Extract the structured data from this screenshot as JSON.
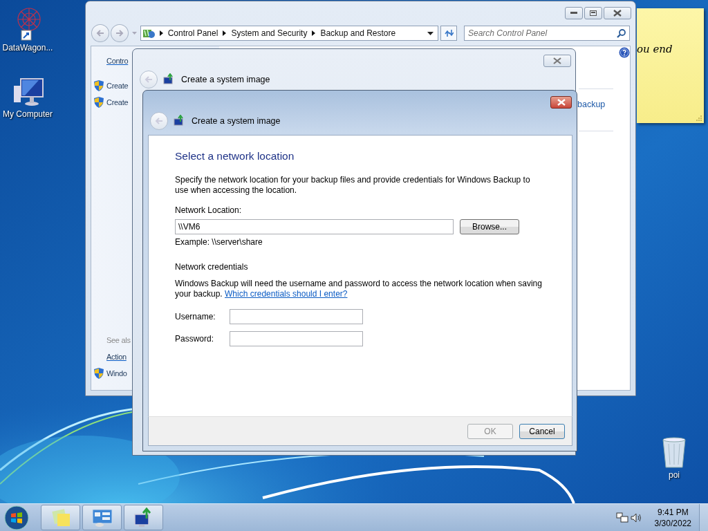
{
  "desktop_icons": [
    {
      "label": "DataWagon...",
      "kind": "app"
    },
    {
      "label": "My Computer",
      "kind": "computer"
    },
    {
      "label": "poi",
      "kind": "bin"
    }
  ],
  "sticky_note": {
    "text": "ou end"
  },
  "control_panel": {
    "breadcrumb": [
      "Control Panel",
      "System and Security",
      "Backup and Restore"
    ],
    "search": {
      "placeholder": "Search Control Panel"
    },
    "sidebar": [
      {
        "label": "Contro",
        "kind": "link"
      },
      {
        "label": "Create",
        "kind": "shield_link"
      },
      {
        "label": "Create",
        "kind": "shield_link"
      },
      {
        "label": "See als",
        "kind": "heading"
      },
      {
        "label": "Action",
        "kind": "link"
      },
      {
        "label": "Windo",
        "kind": "shield_link"
      }
    ],
    "content_link": "backup"
  },
  "back_dialog": {
    "title": "Create a system image"
  },
  "dialog": {
    "title": "Create a system image",
    "heading": "Select a network location",
    "intro": "Specify the network location for your backup files and provide credentials for Windows Backup to use when accessing the location.",
    "location_label": "Network Location:",
    "location_value": "\\\\VM6",
    "browse": "Browse...",
    "example": "Example: \\\\server\\share",
    "credentials_heading": "Network credentials",
    "credentials_text": "Windows Backup will need the username and password to access the network location when saving your backup.",
    "credentials_link": "Which credentials should I enter?",
    "fields": [
      {
        "label": "Username:"
      },
      {
        "label": "Password:"
      }
    ],
    "ok": {
      "label": "OK",
      "disabled": true
    },
    "cancel": {
      "label": "Cancel",
      "disabled": false
    }
  },
  "taskbar": {
    "items": [
      {
        "kind": "sticky"
      },
      {
        "kind": "control"
      },
      {
        "kind": "backup"
      }
    ],
    "time": "9:41 PM",
    "date": "3/30/2022"
  }
}
